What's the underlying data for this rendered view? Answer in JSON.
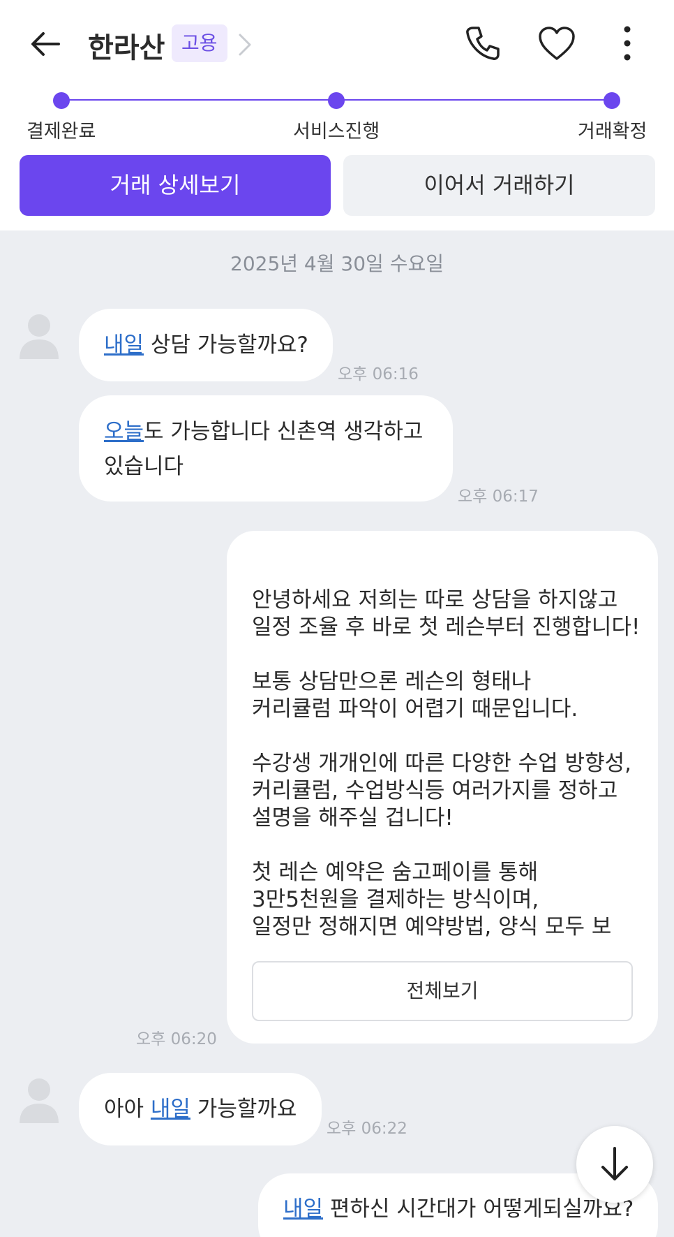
{
  "header": {
    "title": "한라산",
    "badge": "고용"
  },
  "progress": {
    "steps": [
      "결제완료",
      "서비스진행",
      "거래확정"
    ]
  },
  "actions": {
    "detail_label": "거래 상세보기",
    "continue_label": "이어서 거래하기"
  },
  "chat": {
    "date": "2025년 4월 30일 수요일",
    "messages": [
      {
        "link": "내일",
        "text": " 상담 가능할까요?",
        "time": "오후 06:16"
      },
      {
        "link": "오늘",
        "text": "도 가능합니다 신촌역 생각하고",
        "text2": "있습니다",
        "time": "오후 06:17"
      },
      {
        "body": "안녕하세요 저희는 따로 상담을 하지않고\n일정 조율 후 바로 첫 레슨부터 진행합니다!\n\n보통 상담만으론 레슨의 형태나\n커리큘럼 파악이 어렵기 때문입니다.\n\n수강생 개개인에 따른 다양한 수업 방향성,\n커리큘럼, 수업방식등 여러가지를 정하고\n설명을 해주실 겁니다!\n\n첫 레슨 예약은 숨고페이를 통해\n3만5천원을 결제하는 방식이며,\n일정만 정해지면 예약방법, 양식 모두 보",
        "button": "전체보기",
        "time": "오후 06:20"
      },
      {
        "pre": "아아 ",
        "link": "내일",
        "text": " 가능할까요",
        "time": "오후 06:22"
      },
      {
        "link": "내일",
        "text": " 편하신 시간대가 어떻게되실까요?"
      }
    ]
  },
  "colors": {
    "accent": "#6b46ee",
    "chat_bg": "#eceef2",
    "link": "#2d6ec9"
  }
}
